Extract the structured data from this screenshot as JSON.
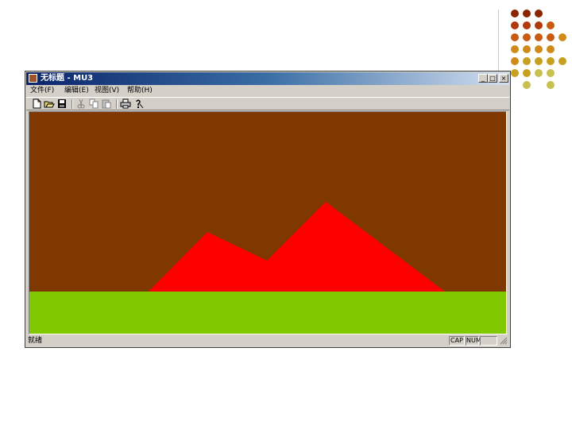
{
  "window": {
    "title": "无标题 - MU3",
    "minimize_label": "_",
    "maximize_label": "□",
    "close_label": "×"
  },
  "menu": {
    "items": [
      {
        "label": "文件(F)"
      },
      {
        "label": "编辑(E)"
      },
      {
        "label": "视图(V)"
      },
      {
        "label": "帮助(H)"
      }
    ]
  },
  "toolbar": {
    "icons": [
      "new-file-icon",
      "open-folder-icon",
      "save-icon",
      "cut-icon",
      "copy-icon",
      "paste-icon",
      "print-icon",
      "help-icon"
    ]
  },
  "scene": {
    "sky_color": "#7f3800",
    "mountain_color": "#ff0000",
    "ground_color": "#80c800"
  },
  "status": {
    "text": "就绪",
    "cap": "CAP",
    "num": "NUM",
    "blank": ""
  },
  "decoration": {
    "dot_colors": [
      "#8b2500",
      "#b03a0a",
      "#c85a12",
      "#d08a1a",
      "#c8a020",
      "#c8c050"
    ]
  }
}
